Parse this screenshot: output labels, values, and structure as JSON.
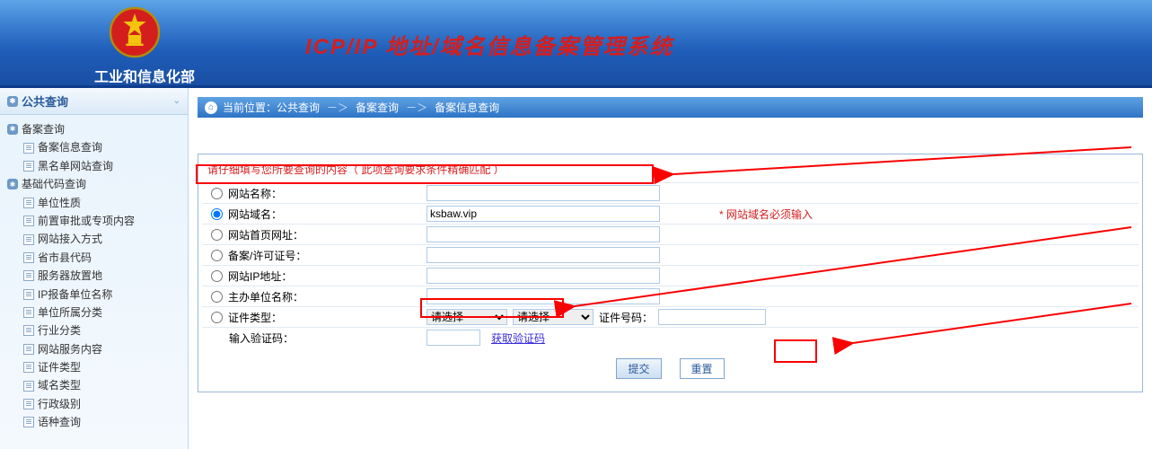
{
  "header": {
    "org_name": "工业和信息化部",
    "sys_title": "ICP/IP 地址/域名信息备案管理系统"
  },
  "sidebar": {
    "title": "公共查询",
    "groups": [
      {
        "label": "备案查询",
        "items": [
          "备案信息查询",
          "黑名单网站查询"
        ]
      },
      {
        "label": "基础代码查询",
        "items": [
          "单位性质",
          "前置审批或专项内容",
          "网站接入方式",
          "省市县代码",
          "服务器放置地",
          "IP报备单位名称",
          "单位所属分类",
          "行业分类",
          "网站服务内容",
          "证件类型",
          "域名类型",
          "行政级别",
          "语种查询"
        ]
      }
    ]
  },
  "breadcrumb": {
    "prefix": "当前位置：",
    "a": "公共查询",
    "b": "备案查询",
    "c": "备案信息查询"
  },
  "form": {
    "note": "请仔细填写您所要查询的内容（ 此项查询要求条件精确匹配 ）",
    "rows": {
      "site_name": "网站名称：",
      "site_domain": "网站域名：",
      "site_home": "网站首页网址：",
      "record_no": "备案/许可证号：",
      "site_ip": "网站IP地址：",
      "sponsor": "主办单位名称：",
      "cert_type": "证件类型：",
      "captcha": "输入验证码："
    },
    "domain_value": "ksbaw.vip",
    "domain_hint": "*  网站域名必须输入",
    "cert_placeholder": "请选择",
    "cert_no_label": "证件号码：",
    "captcha_link": "获取验证码"
  },
  "buttons": {
    "submit": "提交",
    "reset": "重置"
  }
}
